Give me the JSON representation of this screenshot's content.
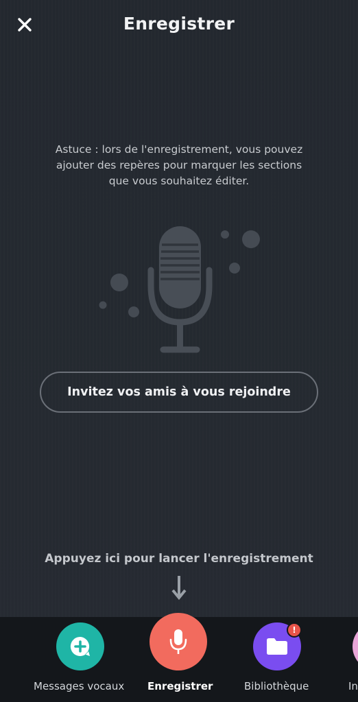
{
  "header": {
    "title": "Enregistrer",
    "close_icon": "close-icon"
  },
  "main": {
    "tip": "Astuce : lors de l'enregistrement, vous pouvez ajouter des repères pour marquer les sections que vous souhaitez éditer.",
    "illustration_icon": "microphone-icon",
    "invite_button": "Invitez vos amis à vous rejoindre",
    "record_hint": "Appuyez ici pour lancer l'enregistrement",
    "hint_icon": "arrow-down-icon"
  },
  "tabbar": {
    "items": [
      {
        "label": "Messages vocaux",
        "icon": "voice-message-plus-icon",
        "color": "#1fb5a6"
      },
      {
        "label": "Enregistrer",
        "icon": "microphone-icon",
        "color": "#f26b5e",
        "active": true
      },
      {
        "label": "Bibliothèque",
        "icon": "folder-icon",
        "color": "#7a4df0",
        "badge": "!"
      },
      {
        "label": "In",
        "icon": "profile-icon",
        "color": "#e9a6d8"
      }
    ]
  },
  "colors": {
    "background": "#252a31",
    "tabbar_background": "#14171b",
    "badge": "#e8544a"
  }
}
